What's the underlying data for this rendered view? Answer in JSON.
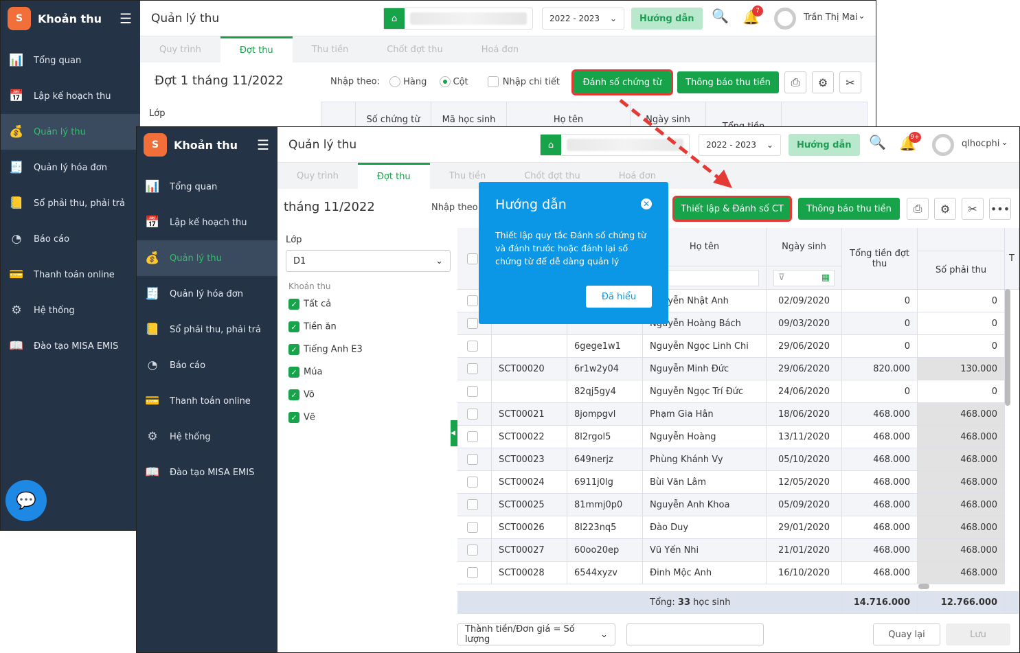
{
  "app": {
    "title": "Khoản thu",
    "page_title": "Quản lý thu",
    "logo_text": "S"
  },
  "sidebar": [
    {
      "label": "Tổng quan",
      "icon": "chart-icon"
    },
    {
      "label": "Lập kế hoạch thu",
      "icon": "calendar-money-icon"
    },
    {
      "label": "Quản lý thu",
      "icon": "hand-money-icon",
      "active": true
    },
    {
      "label": "Quản lý hóa đơn",
      "icon": "invoice-icon"
    },
    {
      "label": "Sổ phải thu, phải trả",
      "icon": "ledger-icon"
    },
    {
      "label": "Báo cáo",
      "icon": "pie-icon"
    },
    {
      "label": "Thanh toán online",
      "icon": "card-icon"
    },
    {
      "label": "Hệ thống",
      "icon": "gear-icon"
    },
    {
      "label": "Đào tạo MISA EMIS",
      "icon": "book-icon"
    }
  ],
  "tabs": [
    "Quy trình",
    "Đợt thu",
    "Thu tiền",
    "Chốt đợt thu",
    "Hoá đơn"
  ],
  "back": {
    "year": "2022 - 2023",
    "guide": "Hướng dẫn",
    "notif": "7",
    "user": "Trần Thị Mai",
    "period": "Đợt 1 tháng 11/2022",
    "input_by": "Nhập theo:",
    "opt_row": "Hàng",
    "opt_col": "Cột",
    "detail": "Nhập chi tiết",
    "number_btn": "Đánh số chứng từ",
    "notify_btn": "Thông báo thu tiền",
    "class_label": "Lớp",
    "cols": [
      "Số chứng từ",
      "Mã học sinh",
      "Họ tên",
      "Ngày sinh",
      "Tổng tiền"
    ]
  },
  "front": {
    "year": "2022 - 2023",
    "guide": "Hướng dẫn",
    "notif": "9+",
    "user": "qlhocphi",
    "period": "tháng 11/2022",
    "input_by": "Nhập theo:",
    "setup_btn": "Thiết lập & Đánh số CT",
    "notify_btn": "Thông báo thu tiền",
    "class_label": "Lớp",
    "class_value": "D1",
    "fee_label": "Khoản thu",
    "fees": [
      "Tất cả",
      "Tiền ăn",
      "Tiếng Anh E3",
      "Múa",
      "Võ",
      "Vẽ"
    ],
    "cols": {
      "name": "Họ tên",
      "dob": "Ngày sinh",
      "total": "Tổng tiền đợt thu",
      "due": "Số phải thu",
      "next": "T"
    },
    "rows": [
      {
        "doc": "",
        "code": "",
        "name": "Nguyễn Nhật Anh",
        "dob": "02/09/2020",
        "total": "0",
        "due": "0"
      },
      {
        "doc": "",
        "code": "",
        "name": "Nguyễn Hoàng Bách",
        "dob": "09/03/2020",
        "total": "0",
        "due": "0"
      },
      {
        "doc": "",
        "code": "6gege1w1",
        "name": "Nguyễn Ngọc Linh Chi",
        "dob": "29/06/2020",
        "total": "0",
        "due": "0"
      },
      {
        "doc": "SCT00020",
        "code": "6r1w2y04",
        "name": "Nguyễn Minh Đức",
        "dob": "29/06/2020",
        "total": "820.000",
        "due": "130.000"
      },
      {
        "doc": "",
        "code": "82qj5gy4",
        "name": "Nguyễn Ngọc Trí Đức",
        "dob": "24/06/2020",
        "total": "0",
        "due": "0"
      },
      {
        "doc": "SCT00021",
        "code": "8jompgvl",
        "name": "Phạm Gia Hân",
        "dob": "18/06/2020",
        "total": "468.000",
        "due": "468.000"
      },
      {
        "doc": "SCT00022",
        "code": "8l2rgol5",
        "name": "Nguyễn Hoàng",
        "dob": "13/11/2020",
        "total": "468.000",
        "due": "468.000"
      },
      {
        "doc": "SCT00023",
        "code": "649nerjz",
        "name": "Phùng Khánh Vy",
        "dob": "05/10/2020",
        "total": "468.000",
        "due": "468.000"
      },
      {
        "doc": "SCT00024",
        "code": "6911j0lg",
        "name": "Bùi Văn Lâm",
        "dob": "12/05/2020",
        "total": "468.000",
        "due": "468.000"
      },
      {
        "doc": "SCT00025",
        "code": "81mmj0p0",
        "name": "Nguyễn Anh Khoa",
        "dob": "05/09/2020",
        "total": "468.000",
        "due": "468.000"
      },
      {
        "doc": "SCT00026",
        "code": "8l223nq5",
        "name": "Đào Duy",
        "dob": "29/01/2020",
        "total": "468.000",
        "due": "468.000"
      },
      {
        "doc": "SCT00027",
        "code": "60oo20ep",
        "name": "Vũ Yến Nhi",
        "dob": "21/01/2020",
        "total": "468.000",
        "due": "468.000"
      },
      {
        "doc": "SCT00028",
        "code": "6544xyzv",
        "name": "Đinh Mộc Anh",
        "dob": "16/10/2020",
        "total": "468.000",
        "due": "468.000"
      }
    ],
    "footer": {
      "label": "Tổng:",
      "count": "33",
      "unit": "học sinh",
      "total": "14.716.000",
      "due": "12.766.000"
    },
    "formula": "Thành tiền/Đơn giá = Số lượng",
    "back_btn": "Quay lại",
    "save_btn": "Lưu"
  },
  "popover": {
    "title": "Hướng dẫn",
    "body": "Thiết lập quy tắc Đánh số chứng từ và đánh trước hoặc đánh lại số chứng từ để dễ dàng quản lý",
    "ok": "Đã hiểu"
  },
  "colors": {
    "sidebar": "#253346",
    "accent": "#16a34a",
    "popover": "#0b96e6",
    "highlight": "#e53935"
  }
}
